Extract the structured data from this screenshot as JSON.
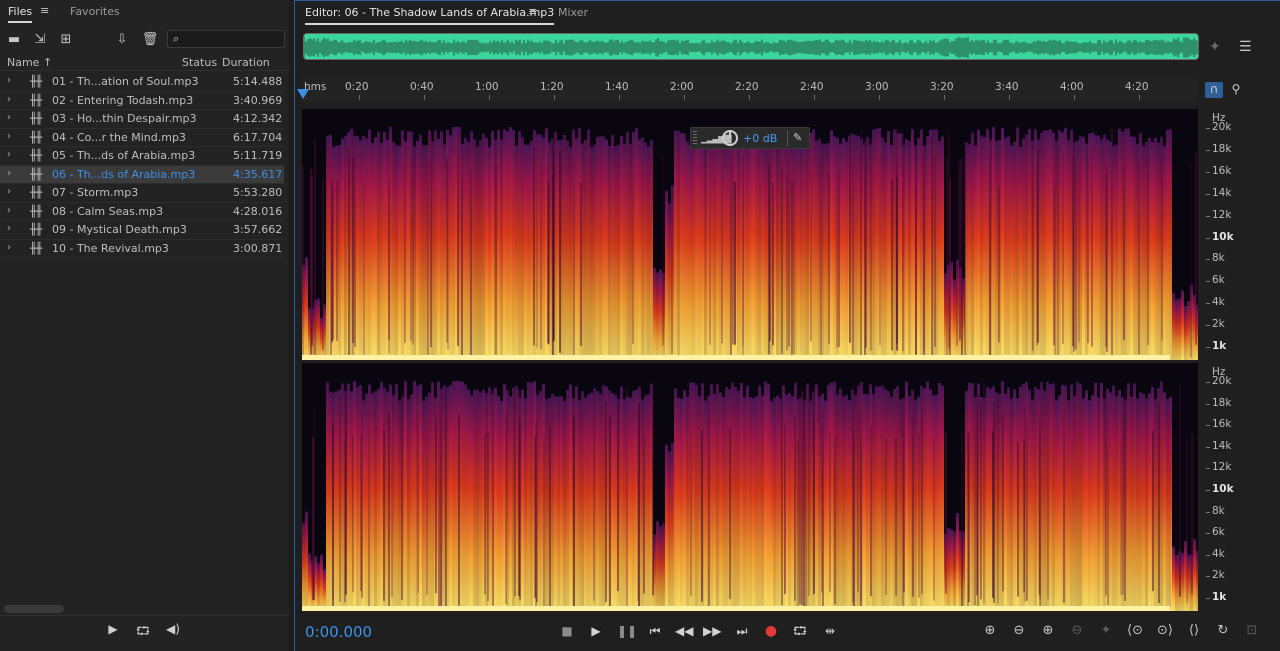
{
  "files_panel": {
    "tabs": [
      {
        "label": "Files",
        "active": true
      },
      {
        "label": "Favorites",
        "active": false
      }
    ],
    "search": {
      "placeholder": "",
      "value": ""
    },
    "columns": {
      "name": "Name",
      "status": "Status",
      "duration": "Duration"
    },
    "files": [
      {
        "name": "01 - Th...ation of Soul.mp3",
        "duration": "5:14.488",
        "selected": false
      },
      {
        "name": "02 - Entering Todash.mp3",
        "duration": "3:40.969",
        "selected": false
      },
      {
        "name": "03 - Ho...thin Despair.mp3",
        "duration": "4:12.342",
        "selected": false
      },
      {
        "name": "04 - Co...r the Mind.mp3",
        "duration": "6:17.704",
        "selected": false
      },
      {
        "name": "05 - Th...ds of Arabia.mp3",
        "duration": "5:11.719",
        "selected": false
      },
      {
        "name": "06 - Th...ds of Arabia.mp3",
        "duration": "4:35.617",
        "selected": true
      },
      {
        "name": "07 - Storm.mp3",
        "duration": "5:53.280",
        "selected": false
      },
      {
        "name": "08 - Calm Seas.mp3",
        "duration": "4:28.016",
        "selected": false
      },
      {
        "name": "09 - Mystical Death.mp3",
        "duration": "3:57.662",
        "selected": false
      },
      {
        "name": "10 - The Revival.mp3",
        "duration": "3:00.871",
        "selected": false
      }
    ]
  },
  "editor": {
    "tabs": [
      {
        "label": "Editor: 06 - The Shadow Lands of Arabia.mp3",
        "active": true
      },
      {
        "label": "Mixer",
        "active": false
      }
    ],
    "ruler_labels": [
      "hms",
      "0:20",
      "0:40",
      "1:00",
      "1:20",
      "1:40",
      "2:00",
      "2:20",
      "2:40",
      "3:00",
      "3:20",
      "3:40",
      "4:00",
      "4:20"
    ],
    "hud": {
      "gain": "+0 dB"
    },
    "hz_unit": "Hz",
    "hz_labels": [
      "20k",
      "18k",
      "16k",
      "14k",
      "12k",
      "10k",
      "8k",
      "6k",
      "4k",
      "2k",
      "1k"
    ],
    "timecode": "0:00.000",
    "colors": {
      "accent": "#3e8fe6",
      "overview_wave": "#3bd69c",
      "record": "#e53a3a",
      "spectrogram_low": "#fbe36a",
      "spectrogram_mid": "#e03b1c",
      "spectrogram_high": "#4a1659"
    }
  }
}
